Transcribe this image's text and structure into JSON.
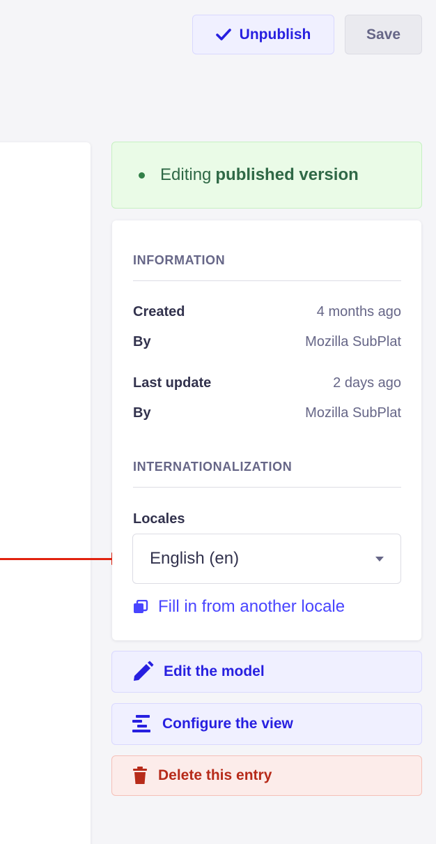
{
  "header": {
    "unpublish_label": "Unpublish",
    "save_label": "Save"
  },
  "status": {
    "prefix": "Editing",
    "emphasis": "published version"
  },
  "information": {
    "title": "INFORMATION",
    "rows": [
      {
        "label": "Created",
        "value": "4 months ago"
      },
      {
        "label": "By",
        "value": "Mozilla SubPlat"
      },
      {
        "label": "Last update",
        "value": "2 days ago"
      },
      {
        "label": "By",
        "value": "Mozilla SubPlat"
      }
    ]
  },
  "i18n": {
    "title": "INTERNATIONALIZATION",
    "locales_label": "Locales",
    "selected_locale": "English (en)",
    "fill_link": "Fill in from another locale"
  },
  "actions": {
    "edit_model": "Edit the model",
    "configure_view": "Configure the view",
    "delete_entry": "Delete this entry"
  },
  "colors": {
    "accent": "#4945ff",
    "accent_dark": "#271fe0",
    "success": "#328048",
    "danger": "#b72b1a",
    "annotation_arrow": "#e1230f"
  }
}
